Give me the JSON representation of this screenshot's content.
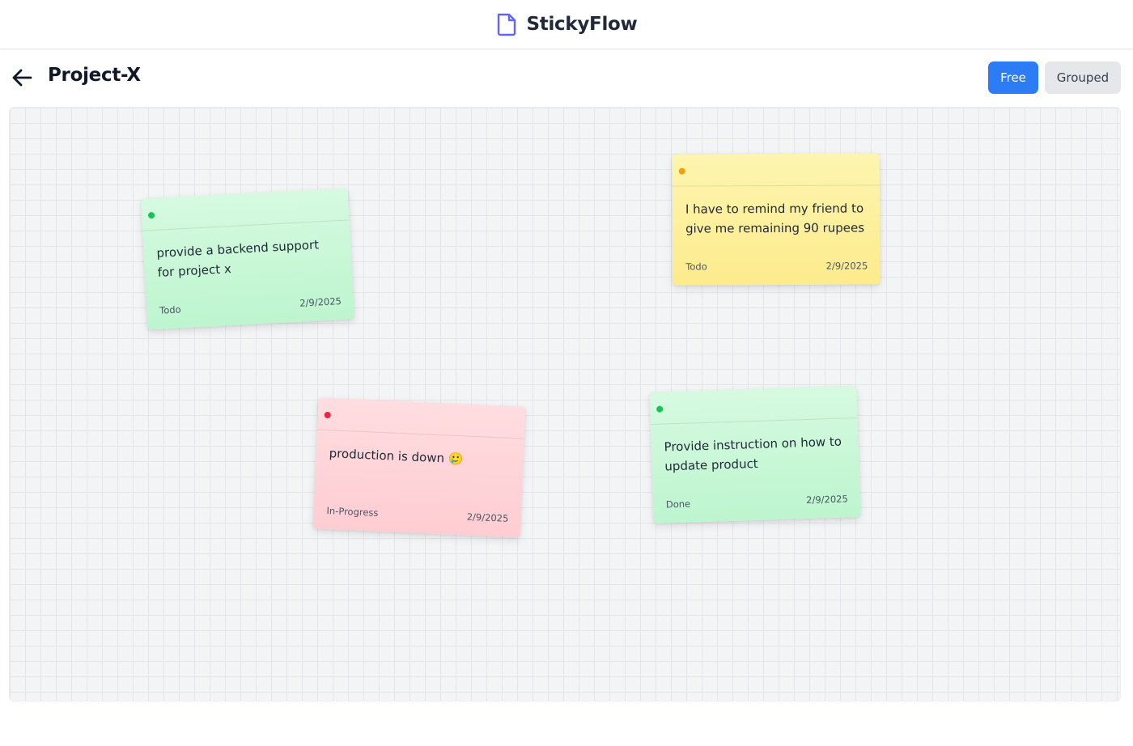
{
  "app": {
    "name": "StickyFlow",
    "icon": "document-icon",
    "accent": "#2b7cf5"
  },
  "project": {
    "title": "Project-X",
    "back_icon": "arrow-left-icon"
  },
  "view_modes": {
    "free_label": "Free",
    "grouped_label": "Grouped",
    "active": "Free"
  },
  "notes": [
    {
      "text": "provide a backend support for project x",
      "status": "Todo",
      "date": "2/9/2025",
      "color": "green",
      "dot_color": "#16c45a"
    },
    {
      "text": "I have to remind my friend to give me remaining 90 rupees",
      "status": "Todo",
      "date": "2/9/2025",
      "color": "yellow",
      "dot_color": "#f59e0b"
    },
    {
      "text": "production is down 🥲",
      "status": "In-Progress",
      "date": "2/9/2025",
      "color": "red",
      "dot_color": "#f0243f"
    },
    {
      "text": "Provide instruction on how to update product",
      "status": "Done",
      "date": "2/9/2025",
      "color": "green",
      "dot_color": "#16c45a"
    }
  ]
}
